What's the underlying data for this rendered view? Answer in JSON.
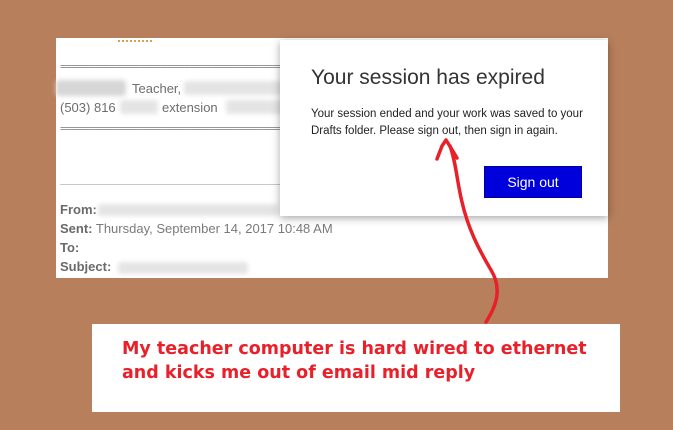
{
  "email": {
    "separator": "=========================================================",
    "signature_line1": "Teacher,",
    "signature_line2_prefix": "(503) 816",
    "signature_line2_suffix": "extension",
    "headers": {
      "from_label": "From:",
      "sent_label": "Sent:",
      "sent_value": "Thursday, September 14, 2017 10:48 AM",
      "to_label": "To:",
      "subject_label": "Subject:"
    }
  },
  "dialog": {
    "title": "Your session has expired",
    "message": "Your session ended and your work was saved to your Drafts folder. Please sign out, then sign in again.",
    "signout_label": "Sign out",
    "button_color": "#0000dd"
  },
  "annotation": {
    "caption": "My teacher computer is hard wired to ethernet and kicks me out of email mid reply",
    "arrow_color": "#e8202a"
  },
  "colors": {
    "background": "#b77f5c",
    "caption_text": "#e8202a"
  }
}
